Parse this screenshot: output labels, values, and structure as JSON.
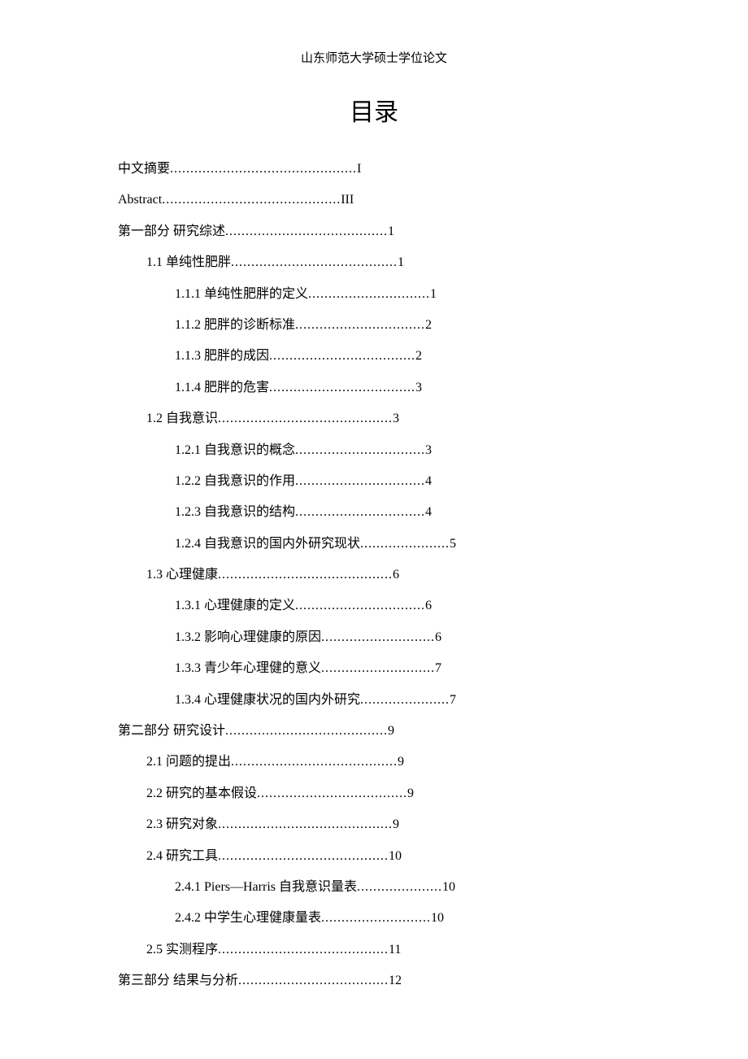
{
  "header": "山东师范大学硕士学位论文",
  "title": "目录",
  "entries": [
    {
      "level": 0,
      "label": "中文摘要 ",
      "page": " I",
      "dots": 46
    },
    {
      "level": 0,
      "label": "Abstract ",
      "page": " III",
      "dots": 44
    },
    {
      "level": 0,
      "label": "第一部分  研究综述 ",
      "page": " 1",
      "dots": 40
    },
    {
      "level": 1,
      "label": "1.1    单纯性肥胖 ",
      "page": "1",
      "dots": 41
    },
    {
      "level": 2,
      "label": "1.1.1  单纯性肥胖的定义 ",
      "page": "1",
      "dots": 30
    },
    {
      "level": 2,
      "label": "1.1.2  肥胖的诊断标准 ",
      "page": "2",
      "dots": 32
    },
    {
      "level": 2,
      "label": "1.1.3  肥胖的成因 ",
      "page": "2",
      "dots": 36
    },
    {
      "level": 2,
      "label": "1.1.4  肥胖的危害 ",
      "page": "3",
      "dots": 36
    },
    {
      "level": 1,
      "label": "1.2  自我意识",
      "page": "3",
      "dots": 43
    },
    {
      "level": 2,
      "label": "1.2.1  自我意识的概念 ",
      "page": "3",
      "dots": 32
    },
    {
      "level": 2,
      "label": "1.2.2  自我意识的作用 ",
      "page": "4",
      "dots": 32
    },
    {
      "level": 2,
      "label": "1.2.3  自我意识的结构 ",
      "page": "4",
      "dots": 32
    },
    {
      "level": 2,
      "label": "1.2.4  自我意识的国内外研究现状 ",
      "page": "5",
      "dots": 22
    },
    {
      "level": 1,
      "label": "1.3  心理健康",
      "page": "6",
      "dots": 43
    },
    {
      "level": 2,
      "label": "1.3.1  心理健康的定义 ",
      "page": "6",
      "dots": 32
    },
    {
      "level": 2,
      "label": "1.3.2  影响心理健康的原因",
      "page": "6",
      "dots": 28
    },
    {
      "level": 2,
      "label": "1.3.3  青少年心理健的意义 ",
      "page": "7",
      "dots": 28
    },
    {
      "level": 2,
      "label": "1.3.4  心理健康状况的国内外研究 ",
      "page": "7",
      "dots": 22
    },
    {
      "level": 0,
      "label": "第二部分  研究设计 ",
      "page": " 9",
      "dots": 40
    },
    {
      "level": 1,
      "label": "2.1  问题的提出",
      "page": "9",
      "dots": 41
    },
    {
      "level": 1,
      "label": "2.2  研究的基本假设 ",
      "page": "9",
      "dots": 37
    },
    {
      "level": 1,
      "label": "2.3  研究对象 ",
      "page": "9",
      "dots": 43
    },
    {
      "level": 1,
      "label": "2.4  研究工具 ",
      "page": "10",
      "dots": 42
    },
    {
      "level": 2,
      "label": "2.4.1 Piers—Harris  自我意识量表 ",
      "page": "10",
      "dots": 21
    },
    {
      "level": 2,
      "label": "2.4.2  中学生心理健康量表 ",
      "page": "10",
      "dots": 27
    },
    {
      "level": 1,
      "label": "2.5  实测程序 ",
      "page": "11",
      "dots": 42
    },
    {
      "level": 0,
      "label": "第三部分  结果与分析 ",
      "page": " 12",
      "dots": 37
    }
  ]
}
